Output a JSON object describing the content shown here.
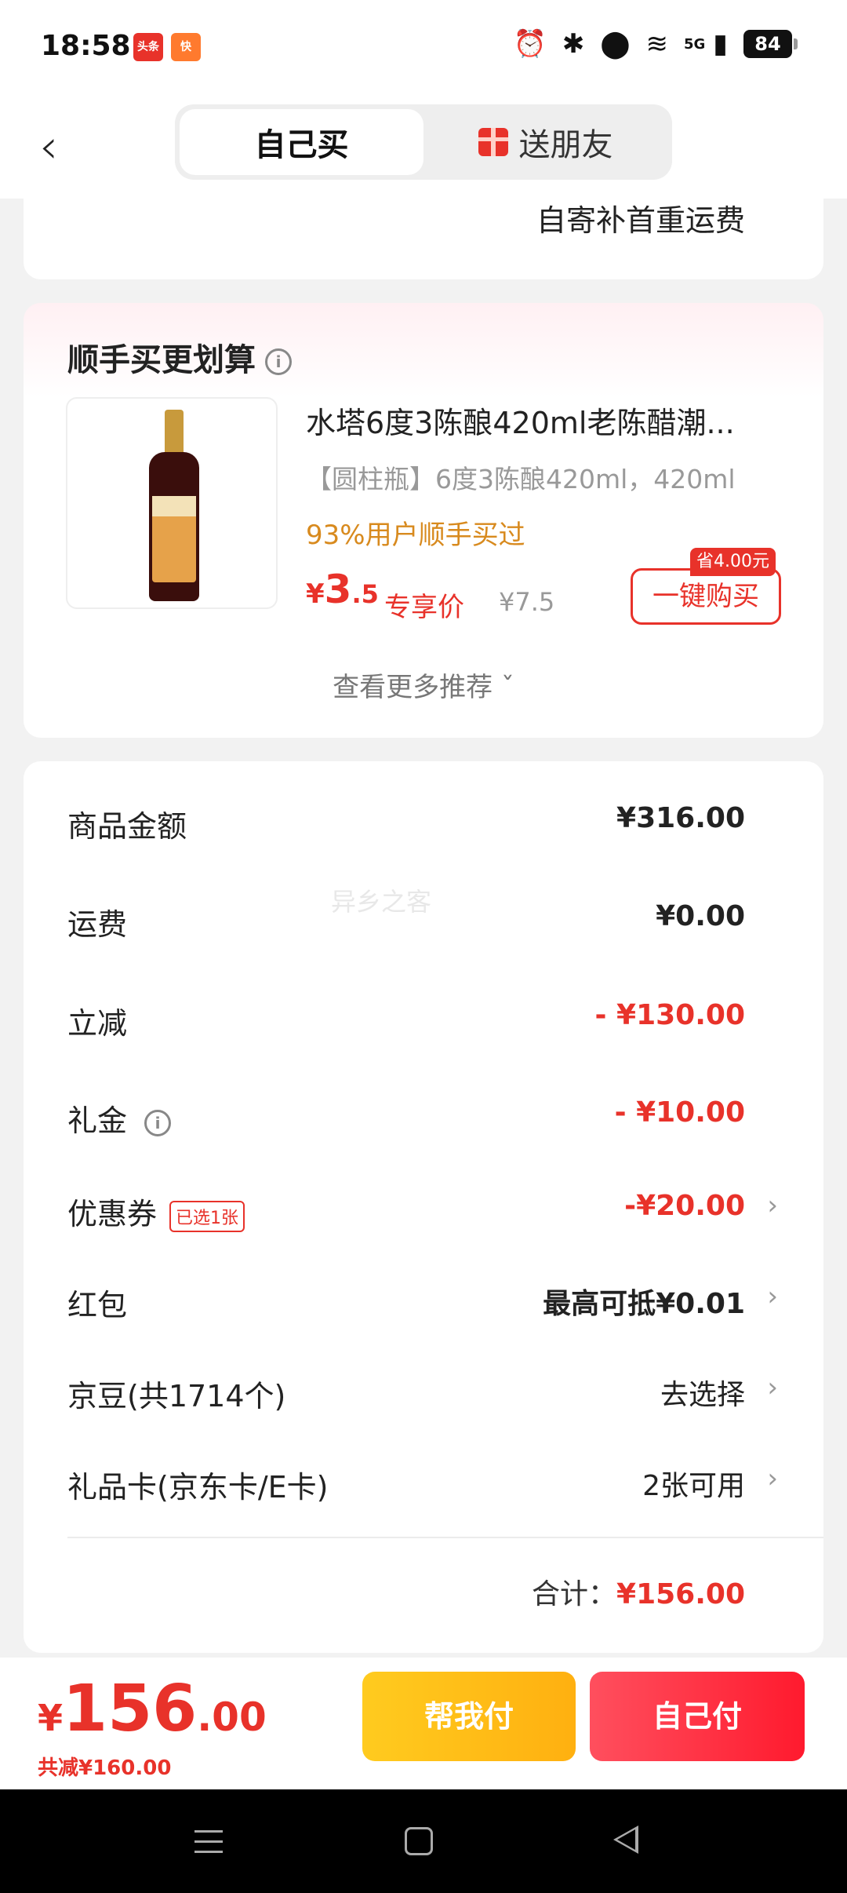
{
  "status_bar": {
    "time": "18:58",
    "network": "5G",
    "battery": "84",
    "app_badges": [
      "头条",
      "快"
    ]
  },
  "header": {
    "tabs": [
      {
        "label": "自己买",
        "active": true
      },
      {
        "label": "送朋友",
        "active": false
      }
    ]
  },
  "shipping": {
    "text": "自寄补首重运费"
  },
  "recommendation": {
    "title": "顺手买更划算",
    "product": {
      "name": "水塔6度3陈酿420ml老陈醋潮...",
      "spec": "【圆柱瓶】6度3陈酿420ml，420ml",
      "social_proof": "93%用户顺手买过",
      "price_symbol": "¥",
      "price_int": "3",
      "price_dec": ".5",
      "price_tag": "专享价",
      "original_price": "¥7.5",
      "buy_label": "一键购买",
      "save_badge": "省4.00元"
    },
    "more_label": "查看更多推荐 ˇ"
  },
  "summary": {
    "watermark": "异乡之客",
    "rows": [
      {
        "label": "商品金额",
        "value": "¥316.00"
      },
      {
        "label": "运费",
        "value": "¥0.00"
      },
      {
        "label": "立减",
        "value": "- ¥130.00"
      },
      {
        "label": "礼金",
        "value": "- ¥10.00"
      },
      {
        "label": "优惠券",
        "chip": "已选1张",
        "value": "-¥20.00"
      },
      {
        "label": "红包",
        "value": "最高可抵¥0.01"
      },
      {
        "label": "京豆(共1714个)",
        "value": "去选择"
      },
      {
        "label": "礼品卡(京东卡/E卡)",
        "value": "2张可用"
      }
    ],
    "total_label": "合计：",
    "total_value": "¥156.00"
  },
  "bottom_bar": {
    "price_symbol": "¥",
    "price_int": "156",
    "price_dec": ".00",
    "saved_text": "共减¥160.00",
    "help_pay_label": "帮我付",
    "self_pay_label": "自己付"
  },
  "colors": {
    "accent_red": "#e8322a",
    "help_yellow": "#ffbe18",
    "orange_text": "#d88a1e"
  },
  "icons": [
    "back-arrow-icon",
    "gift-icon",
    "info-icon",
    "chevron-right-icon",
    "alarm-icon",
    "bluetooth-icon",
    "location-icon",
    "wifi-icon",
    "signal-icon",
    "battery-icon"
  ]
}
